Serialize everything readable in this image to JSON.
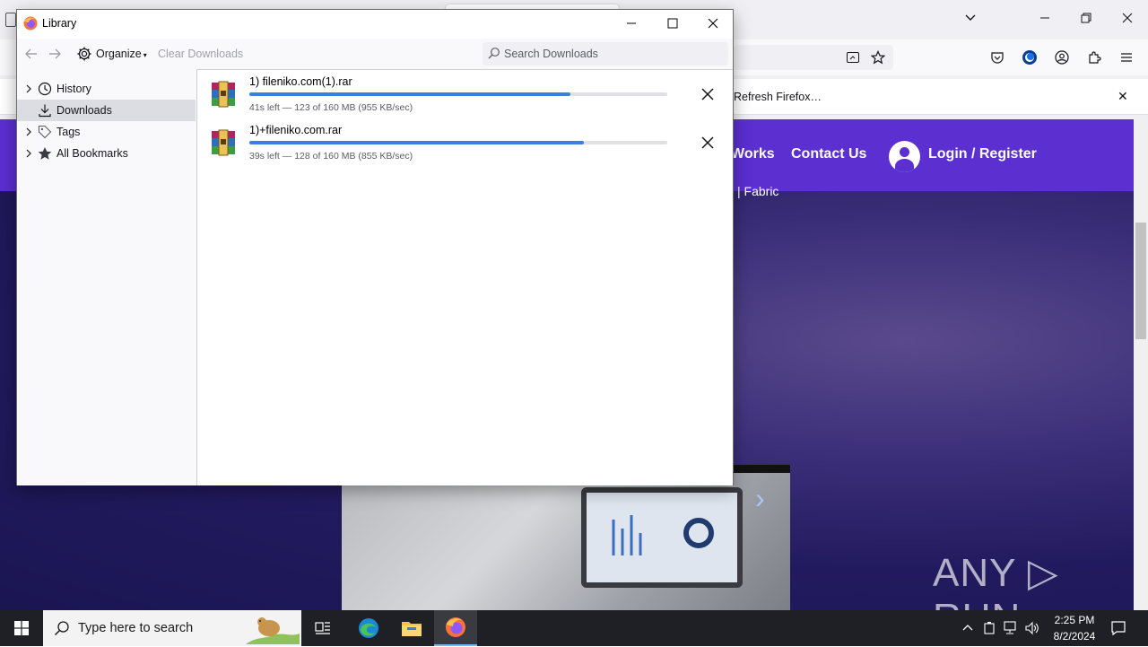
{
  "browser": {
    "notification": {
      "button_label": "Refresh Firefox…"
    },
    "site_nav": {
      "link_works": "Works",
      "link_contact": "Contact Us",
      "link_login": "Login / Register"
    },
    "sub_text": "| Fabric",
    "watermark": "ANY ▷ RUN"
  },
  "library": {
    "title": "Library",
    "toolbar": {
      "organize_label": "Organize",
      "clear_downloads_label": "Clear Downloads",
      "search_placeholder": "Search Downloads",
      "search_value": ""
    },
    "sidebar": {
      "items": [
        {
          "label": "History",
          "icon": "clock-icon",
          "expandable": true,
          "selected": false
        },
        {
          "label": "Downloads",
          "icon": "download-icon",
          "expandable": false,
          "selected": true
        },
        {
          "label": "Tags",
          "icon": "tag-icon",
          "expandable": true,
          "selected": false
        },
        {
          "label": "All Bookmarks",
          "icon": "star-icon",
          "expandable": true,
          "selected": false
        }
      ]
    },
    "downloads": [
      {
        "name": "1) fileniko.com(1).rar",
        "status": "41s left — 123 of 160 MB (955 KB/sec)",
        "progress": 0.769,
        "icon": "winrar-archive-icon"
      },
      {
        "name": "1)+fileniko.com.rar",
        "status": "39s left — 128 of 160 MB (855 KB/sec)",
        "progress": 0.8,
        "icon": "winrar-archive-icon"
      }
    ]
  },
  "taskbar": {
    "search_placeholder": "Type here to search",
    "time": "2:25 PM",
    "date": "8/2/2024"
  },
  "colors": {
    "progress": "#0060df",
    "site_nav": "#5b2fd0",
    "taskbar": "#1f2025"
  }
}
